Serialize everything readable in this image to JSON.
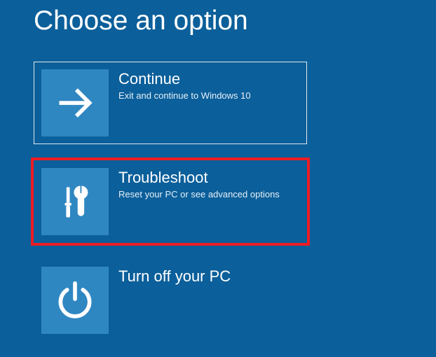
{
  "title": "Choose an option",
  "options": [
    {
      "icon": "arrow-right",
      "title": "Continue",
      "description": "Exit and continue to Windows 10",
      "framed": true,
      "highlighted": false
    },
    {
      "icon": "tools",
      "title": "Troubleshoot",
      "description": "Reset your PC or see advanced options",
      "framed": false,
      "highlighted": true
    },
    {
      "icon": "power",
      "title": "Turn off your PC",
      "description": "",
      "framed": false,
      "highlighted": false
    }
  ]
}
